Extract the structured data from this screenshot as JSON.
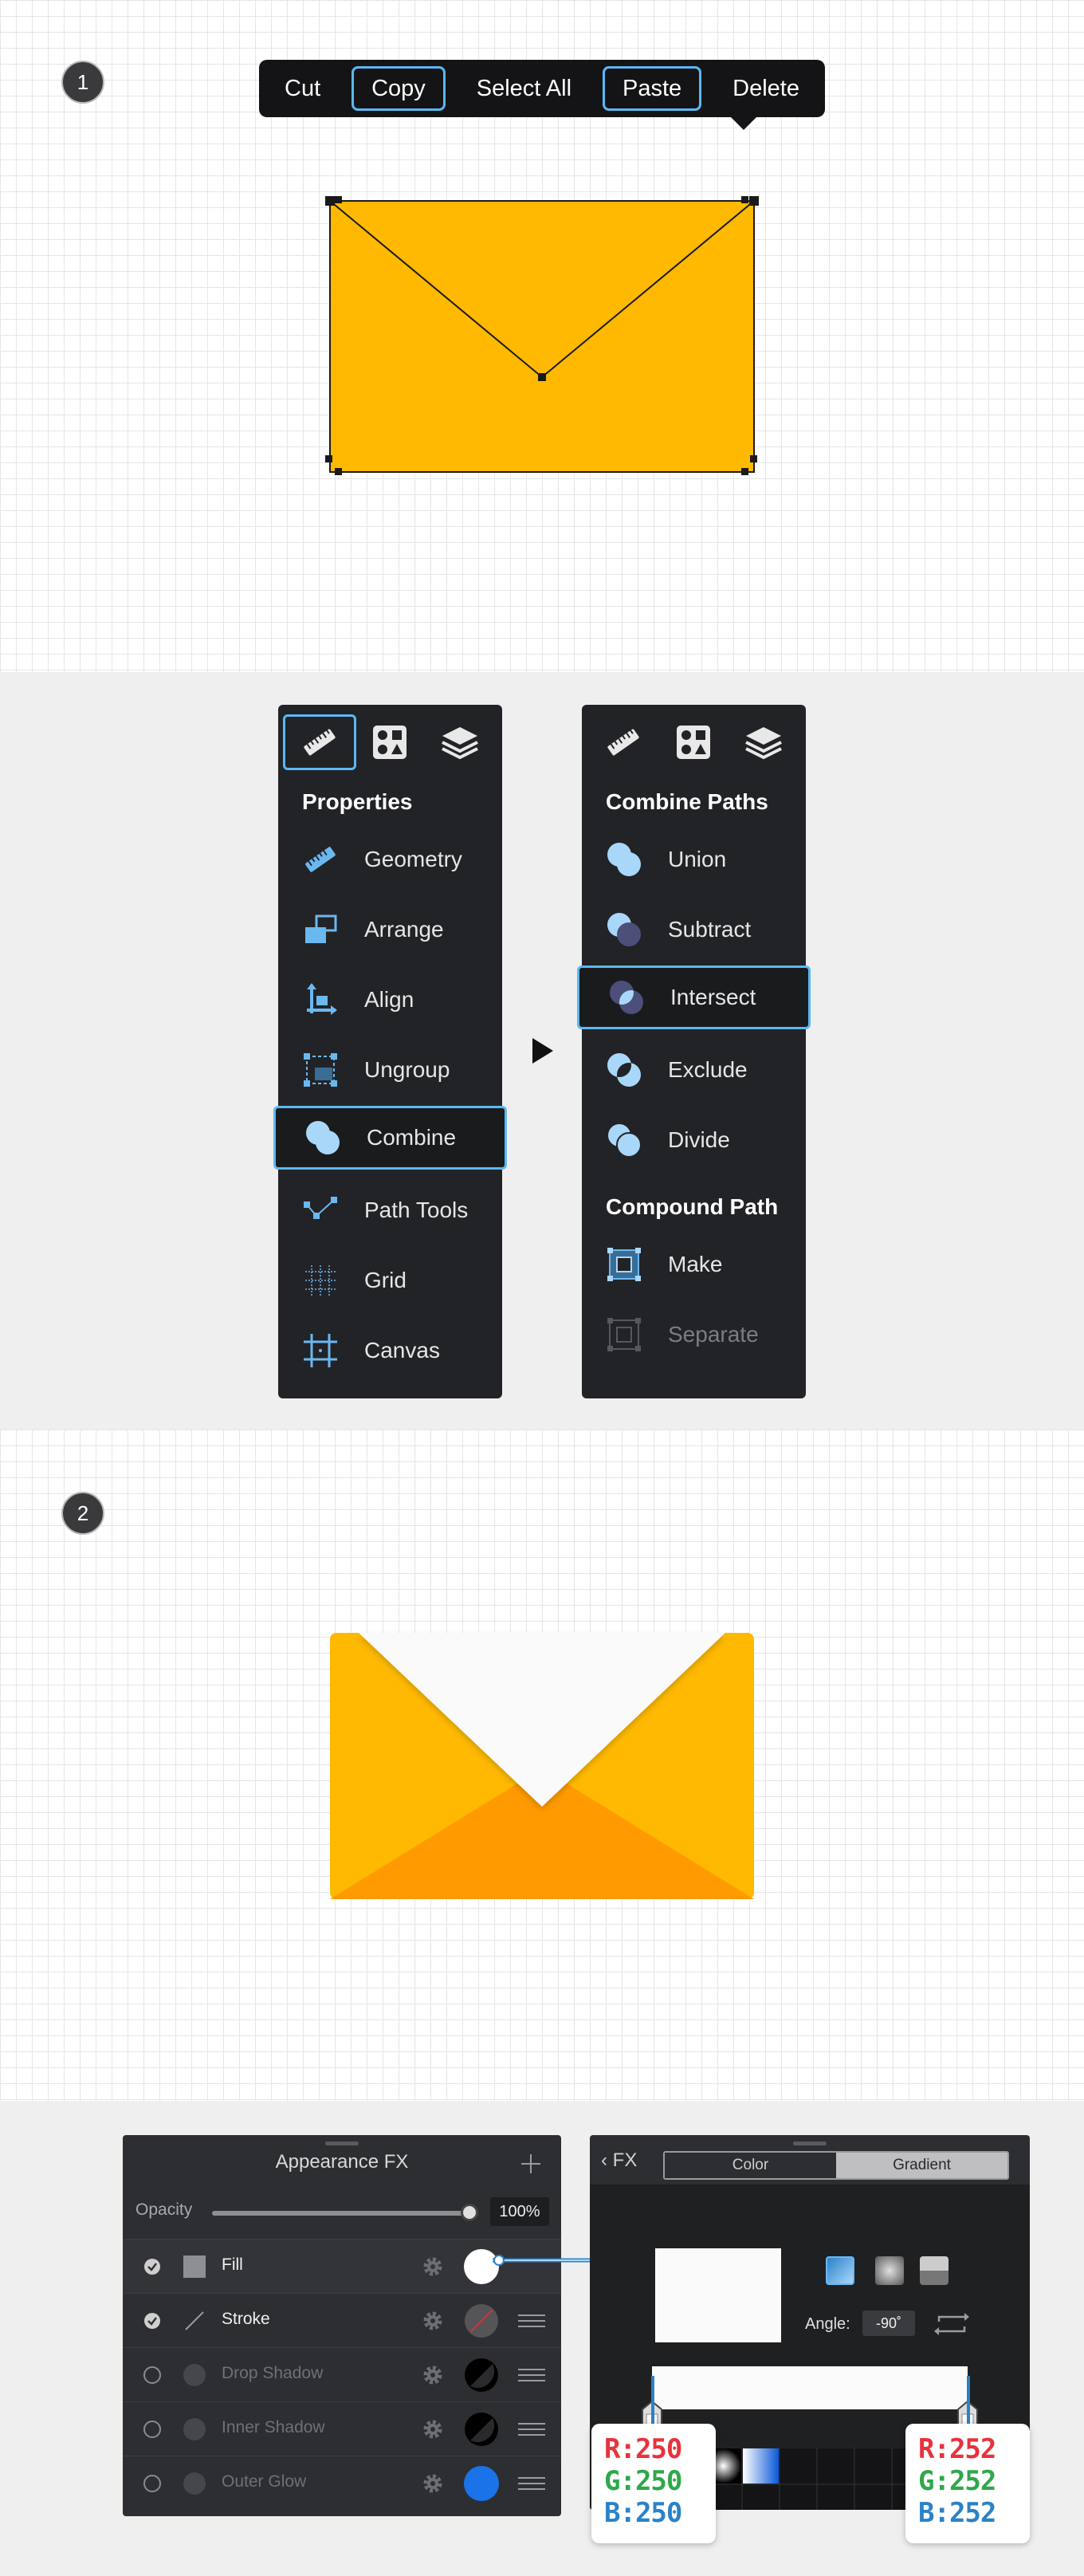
{
  "step1": {
    "badge": "1",
    "context_menu": {
      "items": [
        "Cut",
        "Copy",
        "Select All",
        "Paste",
        "Delete"
      ],
      "highlighted": [
        "Copy",
        "Paste"
      ]
    },
    "shape": {
      "fill_color": "#ffb900"
    }
  },
  "properties_panel": {
    "heading": "Properties",
    "tabs": [
      "ruler-icon",
      "shapes-icon",
      "layers-icon"
    ],
    "active_tab": "ruler-icon",
    "items": [
      {
        "label": "Geometry",
        "icon": "ruler-icon"
      },
      {
        "label": "Arrange",
        "icon": "arrange-icon"
      },
      {
        "label": "Align",
        "icon": "align-icon"
      },
      {
        "label": "Ungroup",
        "icon": "ungroup-icon"
      },
      {
        "label": "Combine",
        "icon": "combine-icon"
      },
      {
        "label": "Path Tools",
        "icon": "path-tools-icon"
      },
      {
        "label": "Grid",
        "icon": "grid-icon"
      },
      {
        "label": "Canvas",
        "icon": "canvas-icon"
      }
    ],
    "highlighted": "Combine"
  },
  "combine_panel": {
    "heading": "Combine Paths",
    "items": [
      {
        "label": "Union",
        "icon": "union-icon"
      },
      {
        "label": "Subtract",
        "icon": "subtract-icon"
      },
      {
        "label": "Intersect",
        "icon": "intersect-icon"
      },
      {
        "label": "Exclude",
        "icon": "exclude-icon"
      },
      {
        "label": "Divide",
        "icon": "divide-icon"
      }
    ],
    "highlighted": "Intersect",
    "compound_heading": "Compound Path",
    "compound_items": [
      {
        "label": "Make",
        "icon": "make-icon",
        "enabled": true
      },
      {
        "label": "Separate",
        "icon": "separate-icon",
        "enabled": false
      }
    ]
  },
  "step2": {
    "badge": "2",
    "envelope_colors": {
      "back": "#ffb900",
      "bottom": "#ff9b00",
      "flap": "#fafafa"
    }
  },
  "appearance_fx": {
    "title": "Appearance FX",
    "opacity_label": "Opacity",
    "opacity_value": "100%",
    "rows": [
      {
        "name": "Fill",
        "enabled": true,
        "color": "#ffffff"
      },
      {
        "name": "Stroke",
        "enabled": true,
        "color": "#555558"
      },
      {
        "name": "Drop Shadow",
        "enabled": false,
        "color": "#000000"
      },
      {
        "name": "Inner Shadow",
        "enabled": false,
        "color": "#000000"
      },
      {
        "name": "Outer Glow",
        "enabled": false,
        "color": "#1a73e8"
      }
    ]
  },
  "gradient_panel": {
    "back_label": "FX",
    "tabs": [
      "Color",
      "Gradient"
    ],
    "active_tab": "Gradient",
    "angle_label": "Angle:",
    "angle_value": "-90˚",
    "stops": [
      {
        "r": "R:250",
        "g": "G:250",
        "b": "B:250"
      },
      {
        "r": "R:252",
        "g": "G:252",
        "b": "B:252"
      }
    ]
  }
}
